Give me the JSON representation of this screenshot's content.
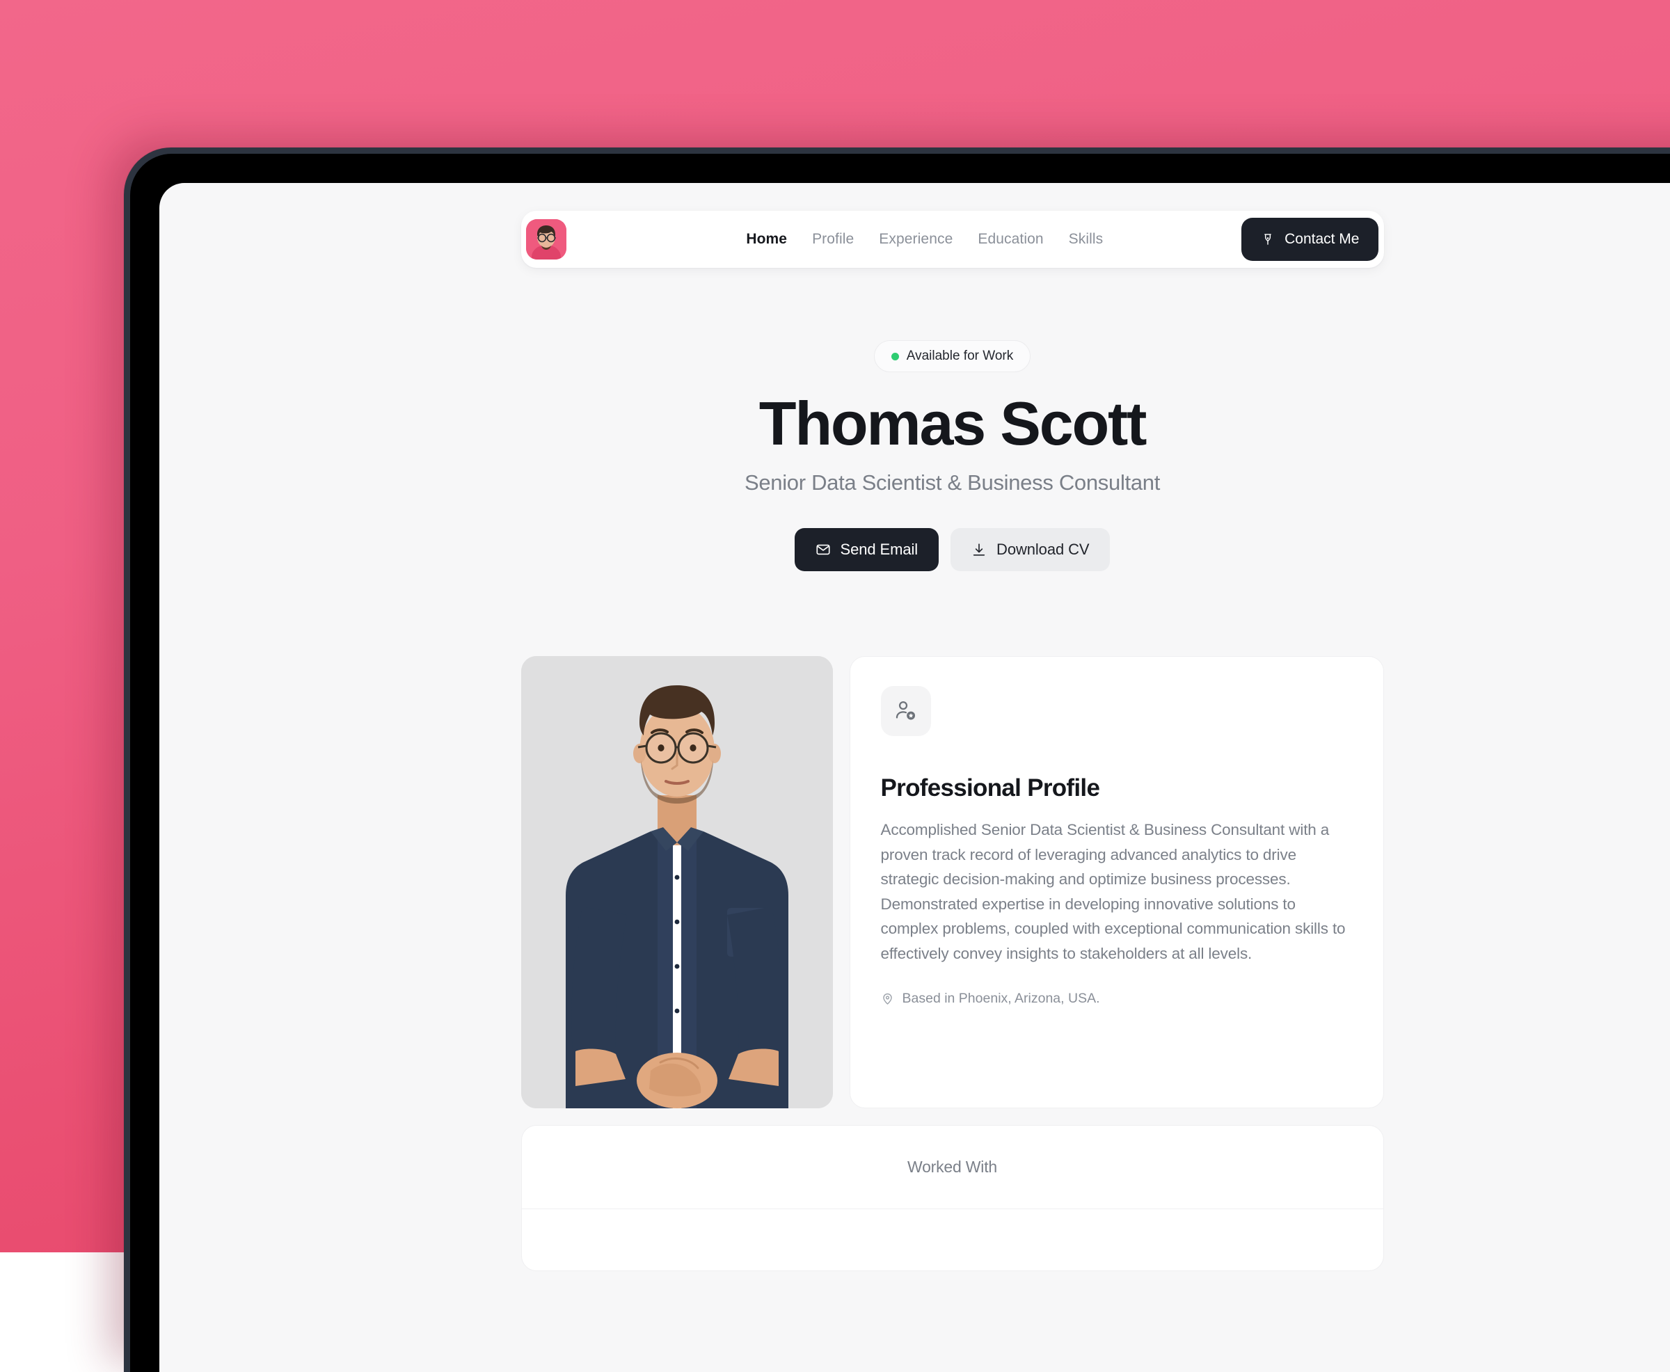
{
  "theme": {
    "backdrop_start": "#f2678a",
    "backdrop_end": "#e64468",
    "bezel": "#2d3440",
    "screen_bg": "#f7f7f8",
    "ink": "#15171c",
    "muted": "#7b8089",
    "accent_dark": "#1c2029",
    "status_green": "#2ecc71",
    "avatar_bg": "#ef5a7e"
  },
  "navbar": {
    "avatar_name": "avatar",
    "links": [
      {
        "label": "Home",
        "active": true
      },
      {
        "label": "Profile",
        "active": false
      },
      {
        "label": "Experience",
        "active": false
      },
      {
        "label": "Education",
        "active": false
      },
      {
        "label": "Skills",
        "active": false
      }
    ],
    "contact_button": {
      "label": "Contact Me",
      "icon": "pen-nib-icon"
    }
  },
  "hero": {
    "badge": {
      "label": "Available for Work",
      "status_icon": "status-dot-icon"
    },
    "name": "Thomas Scott",
    "role": "Senior Data Scientist & Business Consultant",
    "actions": [
      {
        "label": "Send Email",
        "icon": "envelope-icon",
        "style": "primary"
      },
      {
        "label": "Download CV",
        "icon": "download-icon",
        "style": "secondary"
      }
    ]
  },
  "profile": {
    "icon": "user-star-icon",
    "title": "Professional Profile",
    "body": "Accomplished Senior Data Scientist & Business Consultant with a proven track record of leveraging advanced analytics to drive strategic decision-making and optimize business processes. Demonstrated expertise in developing innovative solutions to complex problems, coupled with exceptional communication skills to effectively convey insights to stakeholders at all levels.",
    "location": "Based in Phoenix, Arizona, USA.",
    "location_icon": "map-pin-icon",
    "photo_alt": "portrait-photo"
  },
  "worked_with": {
    "title": "Worked With"
  }
}
